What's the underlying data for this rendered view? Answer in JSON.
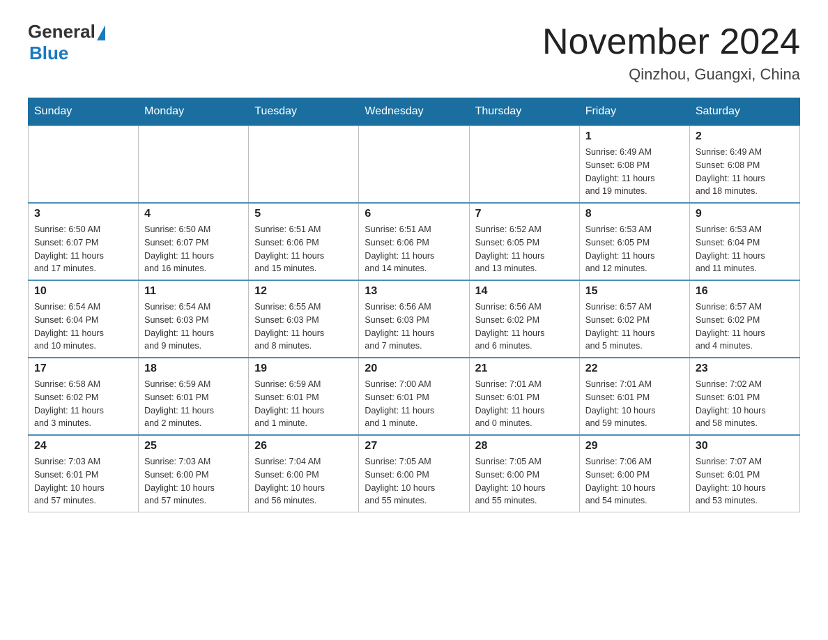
{
  "header": {
    "logo_general": "General",
    "logo_blue": "Blue",
    "title": "November 2024",
    "subtitle": "Qinzhou, Guangxi, China"
  },
  "weekdays": [
    "Sunday",
    "Monday",
    "Tuesday",
    "Wednesday",
    "Thursday",
    "Friday",
    "Saturday"
  ],
  "weeks": [
    [
      {
        "day": "",
        "info": ""
      },
      {
        "day": "",
        "info": ""
      },
      {
        "day": "",
        "info": ""
      },
      {
        "day": "",
        "info": ""
      },
      {
        "day": "",
        "info": ""
      },
      {
        "day": "1",
        "info": "Sunrise: 6:49 AM\nSunset: 6:08 PM\nDaylight: 11 hours\nand 19 minutes."
      },
      {
        "day": "2",
        "info": "Sunrise: 6:49 AM\nSunset: 6:08 PM\nDaylight: 11 hours\nand 18 minutes."
      }
    ],
    [
      {
        "day": "3",
        "info": "Sunrise: 6:50 AM\nSunset: 6:07 PM\nDaylight: 11 hours\nand 17 minutes."
      },
      {
        "day": "4",
        "info": "Sunrise: 6:50 AM\nSunset: 6:07 PM\nDaylight: 11 hours\nand 16 minutes."
      },
      {
        "day": "5",
        "info": "Sunrise: 6:51 AM\nSunset: 6:06 PM\nDaylight: 11 hours\nand 15 minutes."
      },
      {
        "day": "6",
        "info": "Sunrise: 6:51 AM\nSunset: 6:06 PM\nDaylight: 11 hours\nand 14 minutes."
      },
      {
        "day": "7",
        "info": "Sunrise: 6:52 AM\nSunset: 6:05 PM\nDaylight: 11 hours\nand 13 minutes."
      },
      {
        "day": "8",
        "info": "Sunrise: 6:53 AM\nSunset: 6:05 PM\nDaylight: 11 hours\nand 12 minutes."
      },
      {
        "day": "9",
        "info": "Sunrise: 6:53 AM\nSunset: 6:04 PM\nDaylight: 11 hours\nand 11 minutes."
      }
    ],
    [
      {
        "day": "10",
        "info": "Sunrise: 6:54 AM\nSunset: 6:04 PM\nDaylight: 11 hours\nand 10 minutes."
      },
      {
        "day": "11",
        "info": "Sunrise: 6:54 AM\nSunset: 6:03 PM\nDaylight: 11 hours\nand 9 minutes."
      },
      {
        "day": "12",
        "info": "Sunrise: 6:55 AM\nSunset: 6:03 PM\nDaylight: 11 hours\nand 8 minutes."
      },
      {
        "day": "13",
        "info": "Sunrise: 6:56 AM\nSunset: 6:03 PM\nDaylight: 11 hours\nand 7 minutes."
      },
      {
        "day": "14",
        "info": "Sunrise: 6:56 AM\nSunset: 6:02 PM\nDaylight: 11 hours\nand 6 minutes."
      },
      {
        "day": "15",
        "info": "Sunrise: 6:57 AM\nSunset: 6:02 PM\nDaylight: 11 hours\nand 5 minutes."
      },
      {
        "day": "16",
        "info": "Sunrise: 6:57 AM\nSunset: 6:02 PM\nDaylight: 11 hours\nand 4 minutes."
      }
    ],
    [
      {
        "day": "17",
        "info": "Sunrise: 6:58 AM\nSunset: 6:02 PM\nDaylight: 11 hours\nand 3 minutes."
      },
      {
        "day": "18",
        "info": "Sunrise: 6:59 AM\nSunset: 6:01 PM\nDaylight: 11 hours\nand 2 minutes."
      },
      {
        "day": "19",
        "info": "Sunrise: 6:59 AM\nSunset: 6:01 PM\nDaylight: 11 hours\nand 1 minute."
      },
      {
        "day": "20",
        "info": "Sunrise: 7:00 AM\nSunset: 6:01 PM\nDaylight: 11 hours\nand 1 minute."
      },
      {
        "day": "21",
        "info": "Sunrise: 7:01 AM\nSunset: 6:01 PM\nDaylight: 11 hours\nand 0 minutes."
      },
      {
        "day": "22",
        "info": "Sunrise: 7:01 AM\nSunset: 6:01 PM\nDaylight: 10 hours\nand 59 minutes."
      },
      {
        "day": "23",
        "info": "Sunrise: 7:02 AM\nSunset: 6:01 PM\nDaylight: 10 hours\nand 58 minutes."
      }
    ],
    [
      {
        "day": "24",
        "info": "Sunrise: 7:03 AM\nSunset: 6:01 PM\nDaylight: 10 hours\nand 57 minutes."
      },
      {
        "day": "25",
        "info": "Sunrise: 7:03 AM\nSunset: 6:00 PM\nDaylight: 10 hours\nand 57 minutes."
      },
      {
        "day": "26",
        "info": "Sunrise: 7:04 AM\nSunset: 6:00 PM\nDaylight: 10 hours\nand 56 minutes."
      },
      {
        "day": "27",
        "info": "Sunrise: 7:05 AM\nSunset: 6:00 PM\nDaylight: 10 hours\nand 55 minutes."
      },
      {
        "day": "28",
        "info": "Sunrise: 7:05 AM\nSunset: 6:00 PM\nDaylight: 10 hours\nand 55 minutes."
      },
      {
        "day": "29",
        "info": "Sunrise: 7:06 AM\nSunset: 6:00 PM\nDaylight: 10 hours\nand 54 minutes."
      },
      {
        "day": "30",
        "info": "Sunrise: 7:07 AM\nSunset: 6:01 PM\nDaylight: 10 hours\nand 53 minutes."
      }
    ]
  ]
}
